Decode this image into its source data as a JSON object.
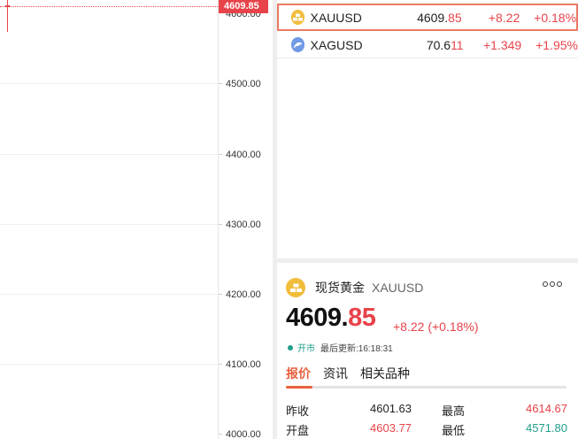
{
  "chart": {
    "axis_ticks": [
      "4500.00",
      "4400.00",
      "4300.00",
      "4200.00",
      "4100.00",
      "4000.00"
    ],
    "top_tick_partial": "4600.00",
    "current_price_tag": "4609.85",
    "colors": {
      "up": "#e8434a",
      "down": "#1f9e8a",
      "grid": "#eeeeee"
    }
  },
  "watchlist": [
    {
      "symbol": "XAUUSD",
      "price_main": "4609.",
      "price_tail": "85",
      "change": "+8.22",
      "pct": "+0.18%",
      "icon": "gold-bar-icon",
      "selected": true
    },
    {
      "symbol": "XAGUSD",
      "price_main": "70.6",
      "price_tail": "11",
      "change": "+1.349",
      "pct": "+1.95%",
      "icon": "silver-bar-icon",
      "selected": false
    }
  ],
  "detail": {
    "name": "现货黄金",
    "code": "XAUUSD",
    "price_main": "4609.",
    "price_tail": "85",
    "change": "+8.22 (+0.18%)",
    "status": "开市",
    "updated": "最后更新:16:18:31",
    "tabs": [
      "报价",
      "资讯",
      "相关品种"
    ],
    "active_tab": 0,
    "quotes": [
      {
        "l1": "昨收",
        "v1": "4601.63",
        "l2": "最高",
        "v2": "4614.67"
      },
      {
        "l1": "开盘",
        "v1": "4603.77",
        "l2": "最低",
        "v2": "4571.80"
      }
    ]
  }
}
